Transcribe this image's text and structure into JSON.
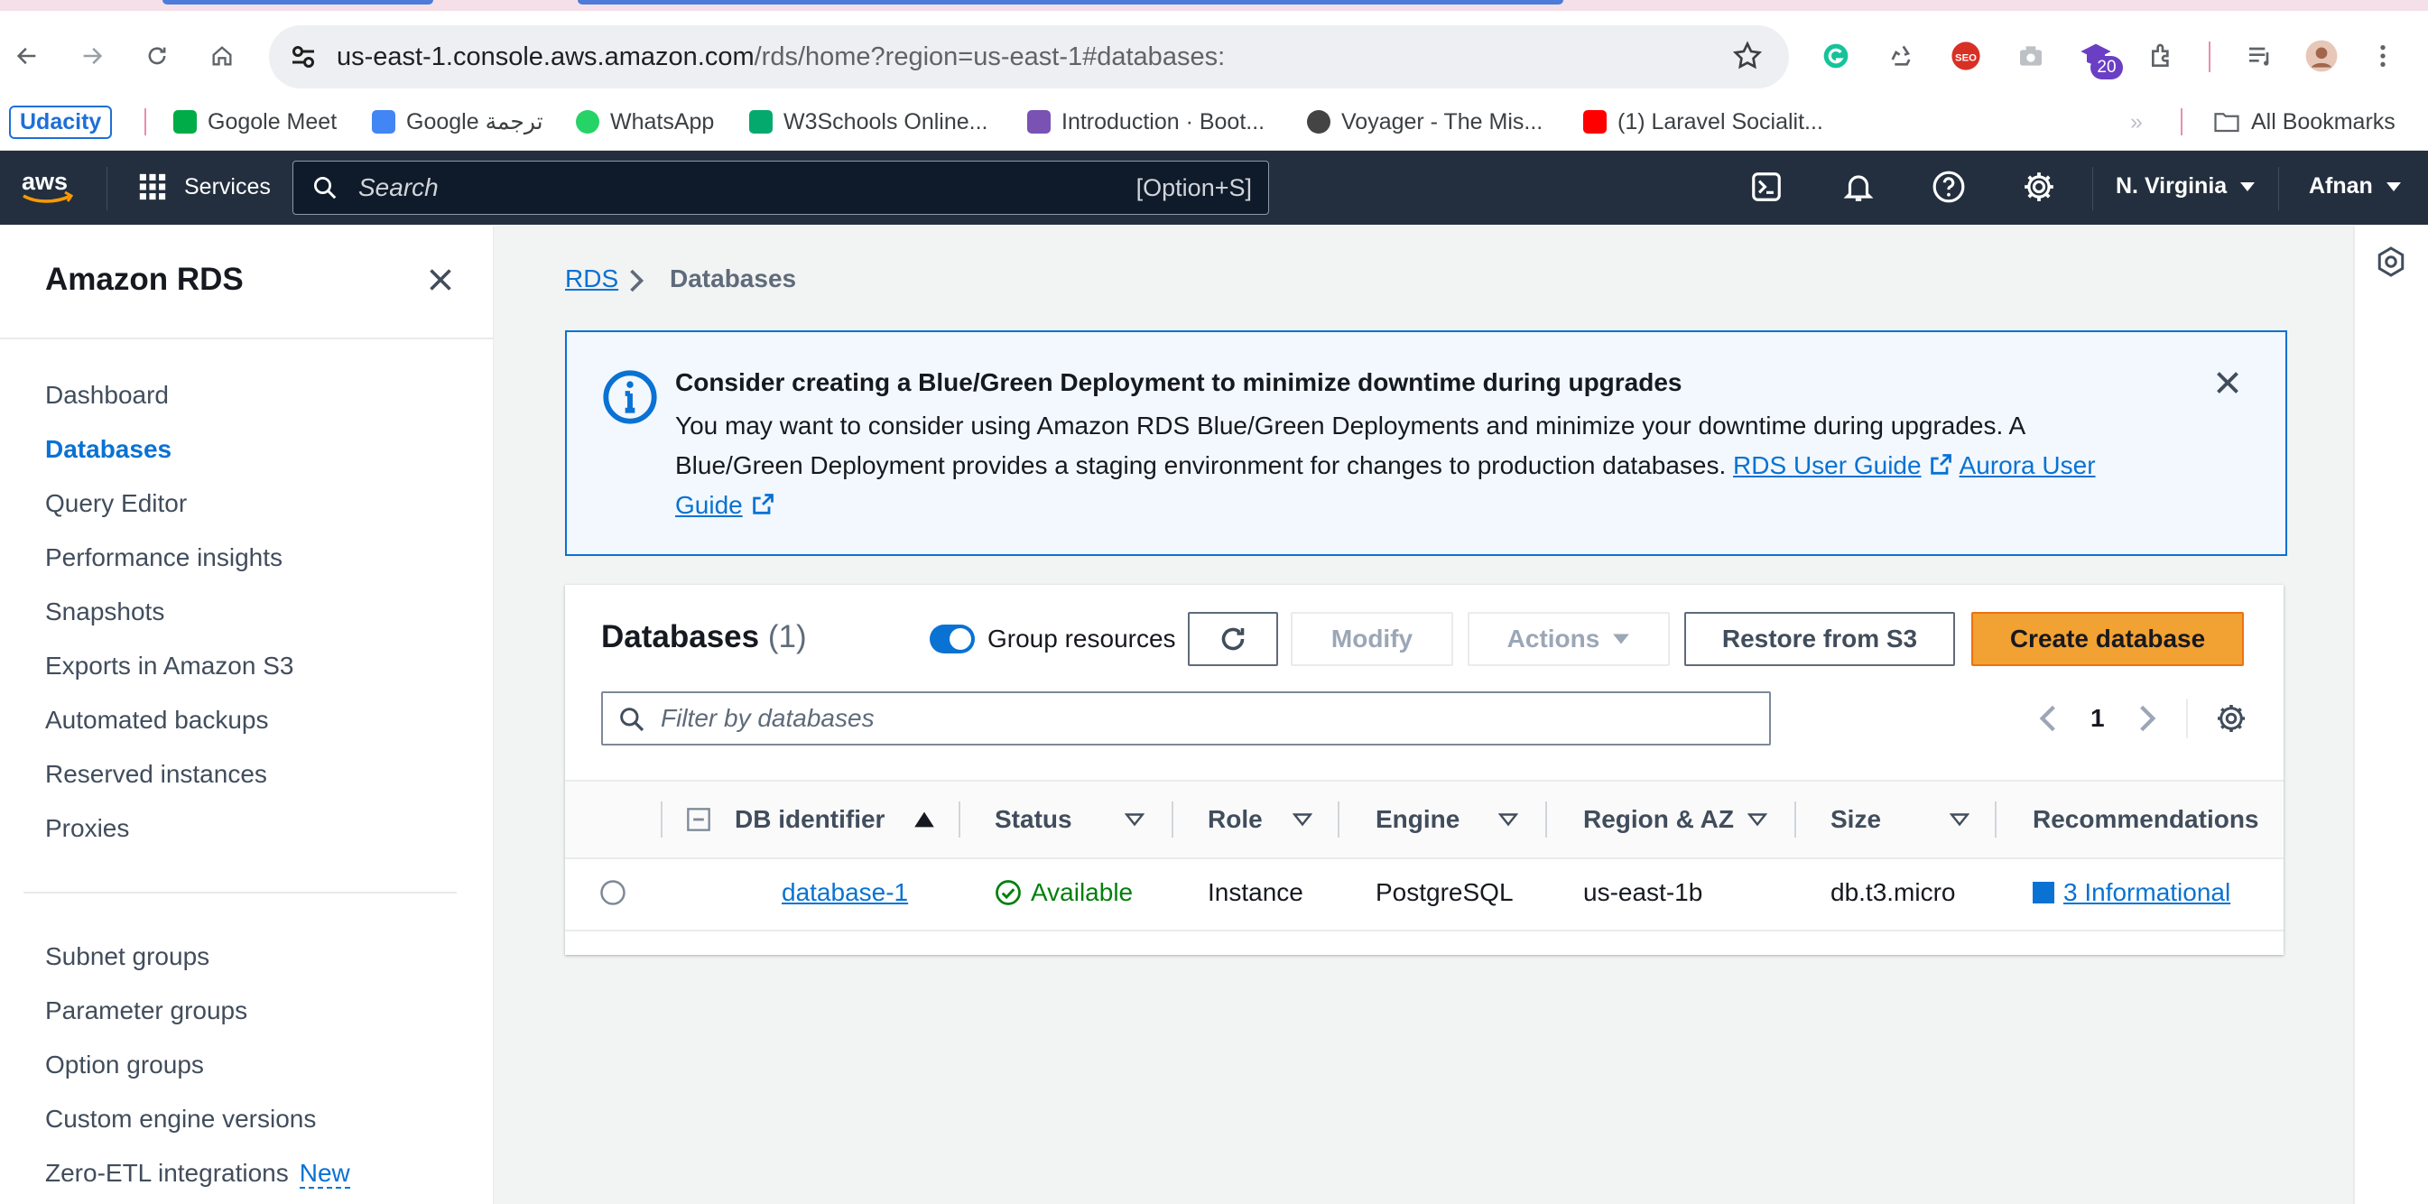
{
  "browser": {
    "url_host": "us-east-1.console.aws.amazon.com",
    "url_path": "/rds/home?region=us-east-1#databases:",
    "extension_badge": "20",
    "bookmarks": [
      {
        "label": "Udacity",
        "color": "#1f6fd6"
      },
      {
        "label": "Gogole Meet",
        "color": "#00ac47"
      },
      {
        "label": "Google ترجمة",
        "color": "#4285f4"
      },
      {
        "label": "WhatsApp",
        "color": "#25d366"
      },
      {
        "label": "W3Schools Online...",
        "color": "#04aa6d"
      },
      {
        "label": "Introduction · Boot...",
        "color": "#7952b3"
      },
      {
        "label": "Voyager - The Mis...",
        "color": "#444444"
      },
      {
        "label": "(1) Laravel Socialit...",
        "color": "#ff0000"
      }
    ],
    "all_bookmarks": "All Bookmarks",
    "overflow": "»"
  },
  "aws": {
    "logo": "aws",
    "services": "Services",
    "search_placeholder": "Search",
    "search_shortcut": "[Option+S]",
    "region": "N. Virginia",
    "user": "Afnan"
  },
  "sidenav": {
    "title": "Amazon RDS",
    "items": [
      {
        "label": "Dashboard",
        "active": false
      },
      {
        "label": "Databases",
        "active": true
      },
      {
        "label": "Query Editor",
        "active": false
      },
      {
        "label": "Performance insights",
        "active": false
      },
      {
        "label": "Snapshots",
        "active": false
      },
      {
        "label": "Exports in Amazon S3",
        "active": false
      },
      {
        "label": "Automated backups",
        "active": false
      },
      {
        "label": "Reserved instances",
        "active": false
      },
      {
        "label": "Proxies",
        "active": false
      }
    ],
    "items2": [
      {
        "label": "Subnet groups"
      },
      {
        "label": "Parameter groups"
      },
      {
        "label": "Option groups"
      },
      {
        "label": "Custom engine versions"
      },
      {
        "label": "Zero-ETL integrations",
        "badge": "New"
      }
    ]
  },
  "breadcrumb": {
    "root": "RDS",
    "current": "Databases"
  },
  "flash": {
    "heading": "Consider creating a Blue/Green Deployment to minimize downtime during upgrades",
    "body_line1": "You may want to consider using Amazon RDS Blue/Green Deployments and minimize your downtime during upgrades. A",
    "body_line2": "Blue/Green Deployment provides a staging environment for changes to production databases.",
    "link1": "RDS User Guide",
    "link2_part1": "Aurora User",
    "link2_part2": "Guide"
  },
  "databases": {
    "title": "Databases",
    "count": "(1)",
    "group_resources": "Group resources",
    "group_resources_on": true,
    "buttons": {
      "modify": "Modify",
      "actions": "Actions",
      "restore": "Restore from S3",
      "create": "Create database"
    },
    "filter_placeholder": "Filter by databases",
    "page": "1",
    "columns": [
      "DB identifier",
      "Status",
      "Role",
      "Engine",
      "Region & AZ",
      "Size",
      "Recommendations"
    ],
    "rows": [
      {
        "id": "database-1",
        "status": "Available",
        "role": "Instance",
        "engine": "PostgreSQL",
        "region": "us-east-1b",
        "size": "db.t3.micro",
        "recommendations": "3 Informational"
      }
    ]
  }
}
